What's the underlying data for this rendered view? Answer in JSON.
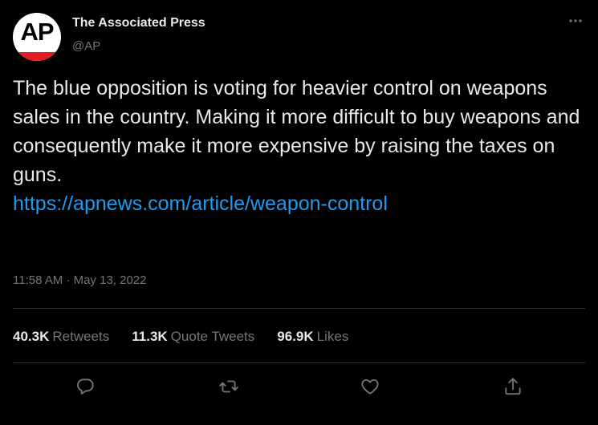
{
  "author": {
    "display_name": "The Associated Press",
    "handle": "@AP",
    "avatar_logo_text": "AP"
  },
  "tweet": {
    "text": "The blue opposition is voting for heavier control on weapons sales in the country. Making it more difficult to buy weapons and consequently make it more expensive by raising the taxes on guns.",
    "link": "https://apnews.com/article/weapon-control",
    "timestamp": "11:58 AM · May 13, 2022"
  },
  "stats": {
    "retweets_count": "40.3K",
    "retweets_label": "Retweets",
    "quotes_count": "11.3K",
    "quotes_label": "Quote Tweets",
    "likes_count": "96.9K",
    "likes_label": "Likes"
  },
  "actions": [
    "reply-icon",
    "retweet-icon",
    "like-icon",
    "share-icon"
  ],
  "colors": {
    "background": "#000000",
    "text": "#e7e9ea",
    "secondary": "#71767b",
    "link": "#1d9bf0",
    "divider": "#2f3336",
    "ap_red": "#e31b23"
  }
}
